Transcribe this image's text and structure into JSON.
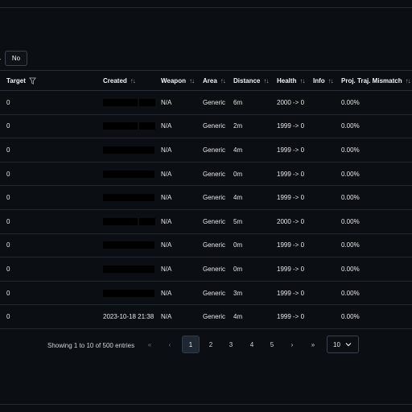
{
  "filter": {
    "chevron": "›",
    "no_label": "No"
  },
  "columns": [
    {
      "label": "Target",
      "icon": "filter-icon"
    },
    {
      "label": "Created",
      "sort": "↑↓"
    },
    {
      "label": "Weapon",
      "sort": "↑↓"
    },
    {
      "label": "Area",
      "sort": "↑↓"
    },
    {
      "label": "Distance",
      "sort": "↑↓"
    },
    {
      "label": "Health",
      "sort": "↑↓"
    },
    {
      "label": "Info",
      "sort": "↑↓"
    },
    {
      "label": "Proj. Traj. Mismatch",
      "sort": "↑↓"
    }
  ],
  "rows": [
    {
      "target": "0",
      "created": "",
      "redacted": true,
      "weapon": "N/A",
      "area": "Generic",
      "distance": "6m",
      "health": "2000 -> 0",
      "mismatch": "0.00%"
    },
    {
      "target": "0",
      "created": "",
      "redacted": true,
      "weapon": "N/A",
      "area": "Generic",
      "distance": "2m",
      "health": "1999 -> 0",
      "mismatch": "0.00%"
    },
    {
      "target": "0",
      "created": "",
      "redacted": true,
      "weapon": "N/A",
      "area": "Generic",
      "distance": "4m",
      "health": "1999 -> 0",
      "mismatch": "0.00%"
    },
    {
      "target": "0",
      "created": "",
      "redacted": true,
      "weapon": "N/A",
      "area": "Generic",
      "distance": "0m",
      "health": "1999 -> 0",
      "mismatch": "0.00%"
    },
    {
      "target": "0",
      "created": "",
      "redacted": true,
      "weapon": "N/A",
      "area": "Generic",
      "distance": "4m",
      "health": "1999 -> 0",
      "mismatch": "0.00%"
    },
    {
      "target": "0",
      "created": "",
      "redacted": true,
      "weapon": "N/A",
      "area": "Generic",
      "distance": "5m",
      "health": "2000 -> 0",
      "mismatch": "0.00%"
    },
    {
      "target": "0",
      "created": "",
      "redacted": true,
      "weapon": "N/A",
      "area": "Generic",
      "distance": "0m",
      "health": "1999 -> 0",
      "mismatch": "0.00%"
    },
    {
      "target": "0",
      "created": "",
      "redacted": true,
      "weapon": "N/A",
      "area": "Generic",
      "distance": "0m",
      "health": "1999 -> 0",
      "mismatch": "0.00%"
    },
    {
      "target": "0",
      "created": "",
      "redacted": true,
      "weapon": "N/A",
      "area": "Generic",
      "distance": "3m",
      "health": "1999 -> 0",
      "mismatch": "0.00%"
    },
    {
      "target": "0",
      "created": "2023-10-18 21:38",
      "redacted": false,
      "weapon": "N/A",
      "area": "Generic",
      "distance": "4m",
      "health": "1999 -> 0",
      "mismatch": "0.00%"
    }
  ],
  "pagination": {
    "info": "Showing 1 to 10 of 500 entries",
    "first": "«",
    "prev": "‹",
    "pages": [
      "1",
      "2",
      "3",
      "4",
      "5"
    ],
    "active_page": "1",
    "next": "›",
    "last": "»",
    "page_size": "10"
  },
  "colors": {
    "background": "#0b0e12",
    "border": "#2a2f37",
    "active_page_bg": "#1f2733"
  }
}
